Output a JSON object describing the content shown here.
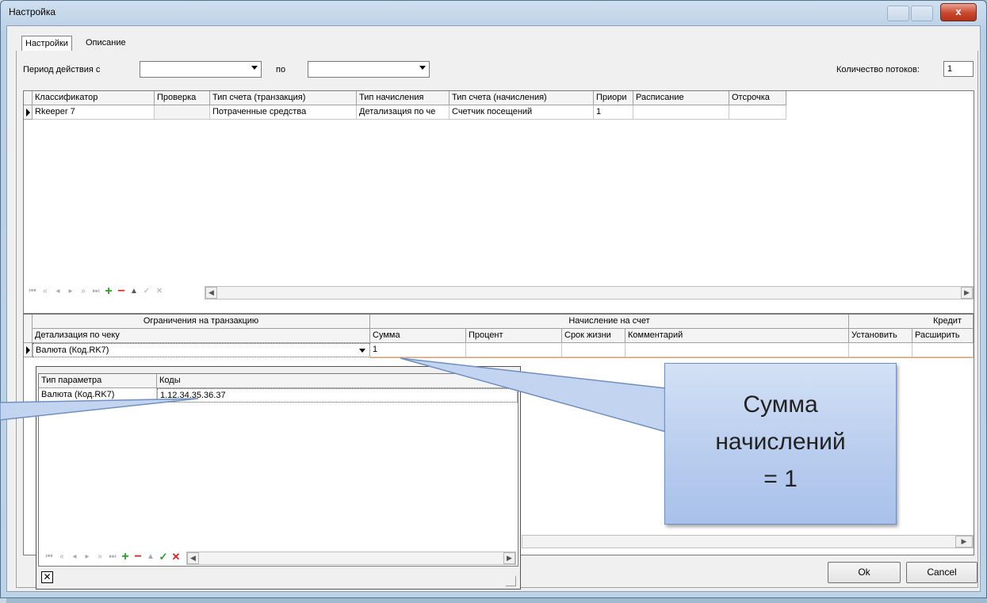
{
  "window": {
    "title": "Настройка",
    "close_label": "x"
  },
  "tabs": [
    {
      "label": "Настройки"
    },
    {
      "label": "Описание"
    }
  ],
  "period": {
    "from_label": "Период действия с",
    "to_label": "по",
    "from_value": "",
    "to_value": ""
  },
  "threads": {
    "label": "Количество потоков:",
    "value": "1"
  },
  "top_grid": {
    "columns": [
      "Классификатор",
      "Проверка",
      "Тип счета (транзакция)",
      "Тип начисления",
      "Тип счета (начисления)",
      "Приори",
      "Расписание",
      "Отсрочка"
    ],
    "rows": [
      [
        "Rkeeper 7",
        "",
        "Потраченные средства",
        "Детализация по че",
        "Счетчик посещений",
        "1",
        "",
        ""
      ]
    ]
  },
  "bottom_grid": {
    "groups": [
      "Ограничения на транзакцию",
      "Начисление на счет",
      "Кредит"
    ],
    "columns": [
      "Детализация по чеку",
      "Сумма",
      "Процент",
      "Срок жизни",
      "Комментарий",
      "Установить",
      "Расширить"
    ],
    "rows": [
      [
        "Валюта (Код.RK7)",
        "1",
        "",
        "",
        "",
        "",
        ""
      ]
    ]
  },
  "popup_grid": {
    "columns": [
      "Тип параметра",
      "Коды"
    ],
    "rows": [
      [
        "Валюта (Код.RK7)",
        "1.12.34.35.36.37"
      ]
    ]
  },
  "buttons": {
    "ok": "Ok",
    "cancel": "Cancel"
  },
  "callout": {
    "line1": "Сумма",
    "line2": "начислений",
    "line3": "= 1"
  },
  "colors": {
    "add": "#2a9d2a",
    "remove": "#dd2222",
    "accent": "#6f8fbf"
  }
}
